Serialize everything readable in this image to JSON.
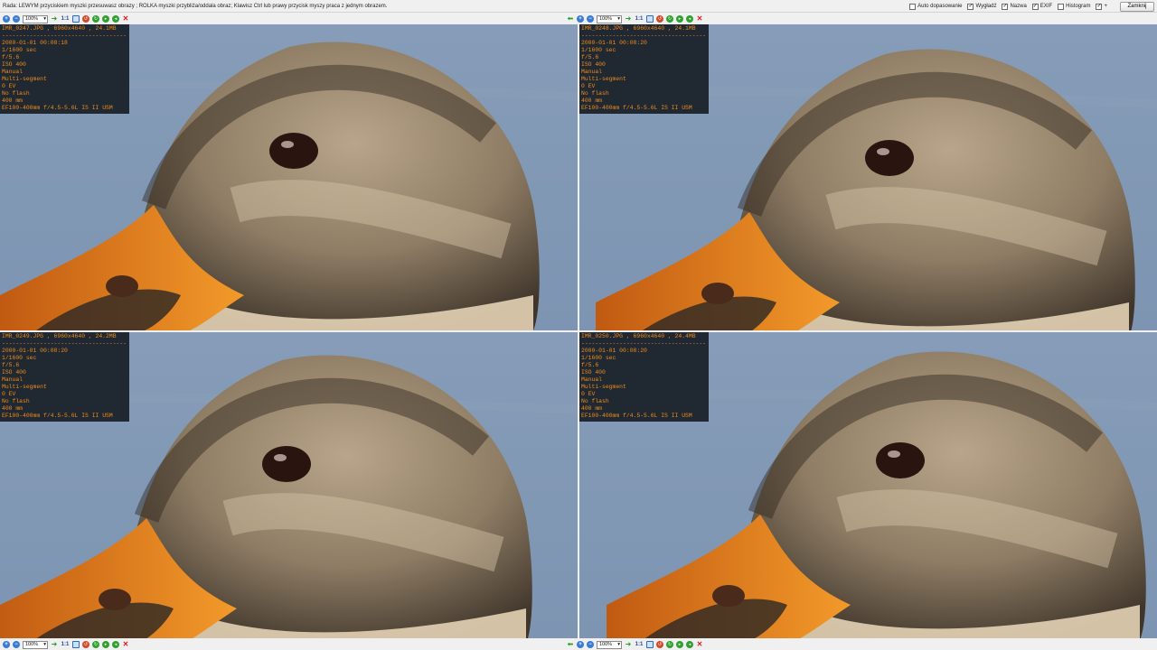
{
  "hint": "Rada: LEWYM przyciskiem myszki przesuwasz obrazy ; ROLKA myszki przybliża/oddala obraz; Klawisz Ctrl lub prawy przycisk myszy praca z jednym obrazem.",
  "options": [
    {
      "label": "Auto dopasowanie",
      "checked": false
    },
    {
      "label": "Wygładź",
      "checked": true
    },
    {
      "label": "Nazwa",
      "checked": true
    },
    {
      "label": "EXIF",
      "checked": true
    },
    {
      "label": "Histogram",
      "checked": false
    },
    {
      "label": "+",
      "checked": true
    }
  ],
  "close_label": "Zamknij",
  "toolbar": {
    "zoom_value": "100%",
    "one_to_one": "1:1",
    "icons": [
      "zoom-in-icon",
      "zoom-out-icon",
      "arrow-right-icon",
      "one-to-one-icon",
      "fit-icon",
      "rotate-left-icon",
      "rotate-right-icon",
      "next-icon",
      "back-icon",
      "close-icon"
    ]
  },
  "dashes": "--------------------------------------------",
  "panes": [
    {
      "filename": "IMR_0247.JPG , 6960x4640 , 24.1MB",
      "exif": [
        "2000-01-01 00:08:18",
        "1/1600 sec",
        "f/5.6",
        "ISO 400",
        "Manual",
        "Multi-segment",
        "0 EV",
        "No flash",
        "400 mm",
        "EF100-400mm f/4.5-5.6L IS II USM"
      ]
    },
    {
      "filename": "IMR_0248.JPG , 6960x4640 , 24.1MB",
      "exif": [
        "2000-01-01 00:08:20",
        "1/1600 sec",
        "f/5.6",
        "ISO 400",
        "Manual",
        "Multi-segment",
        "0 EV",
        "No flash",
        "400 mm",
        "EF100-400mm f/4.5-5.6L IS II USM"
      ]
    },
    {
      "filename": "IMR_0249.JPG , 6960x4640 , 24.2MB",
      "exif": [
        "2000-01-01 00:08:20",
        "1/1600 sec",
        "f/5.6",
        "ISO 400",
        "Manual",
        "Multi-segment",
        "0 EV",
        "No flash",
        "400 mm",
        "EF100-400mm f/4.5-5.6L IS II USM"
      ]
    },
    {
      "filename": "IMR_0250.JPG , 6960x4640 , 24.4MB",
      "exif": [
        "2000-01-01 00:08:20",
        "1/1600 sec",
        "f/5.6",
        "ISO 400",
        "Manual",
        "Multi-segment",
        "0 EV",
        "No flash",
        "400 mm",
        "EF100-400mm f/4.5-5.6L IS II USM"
      ]
    }
  ]
}
